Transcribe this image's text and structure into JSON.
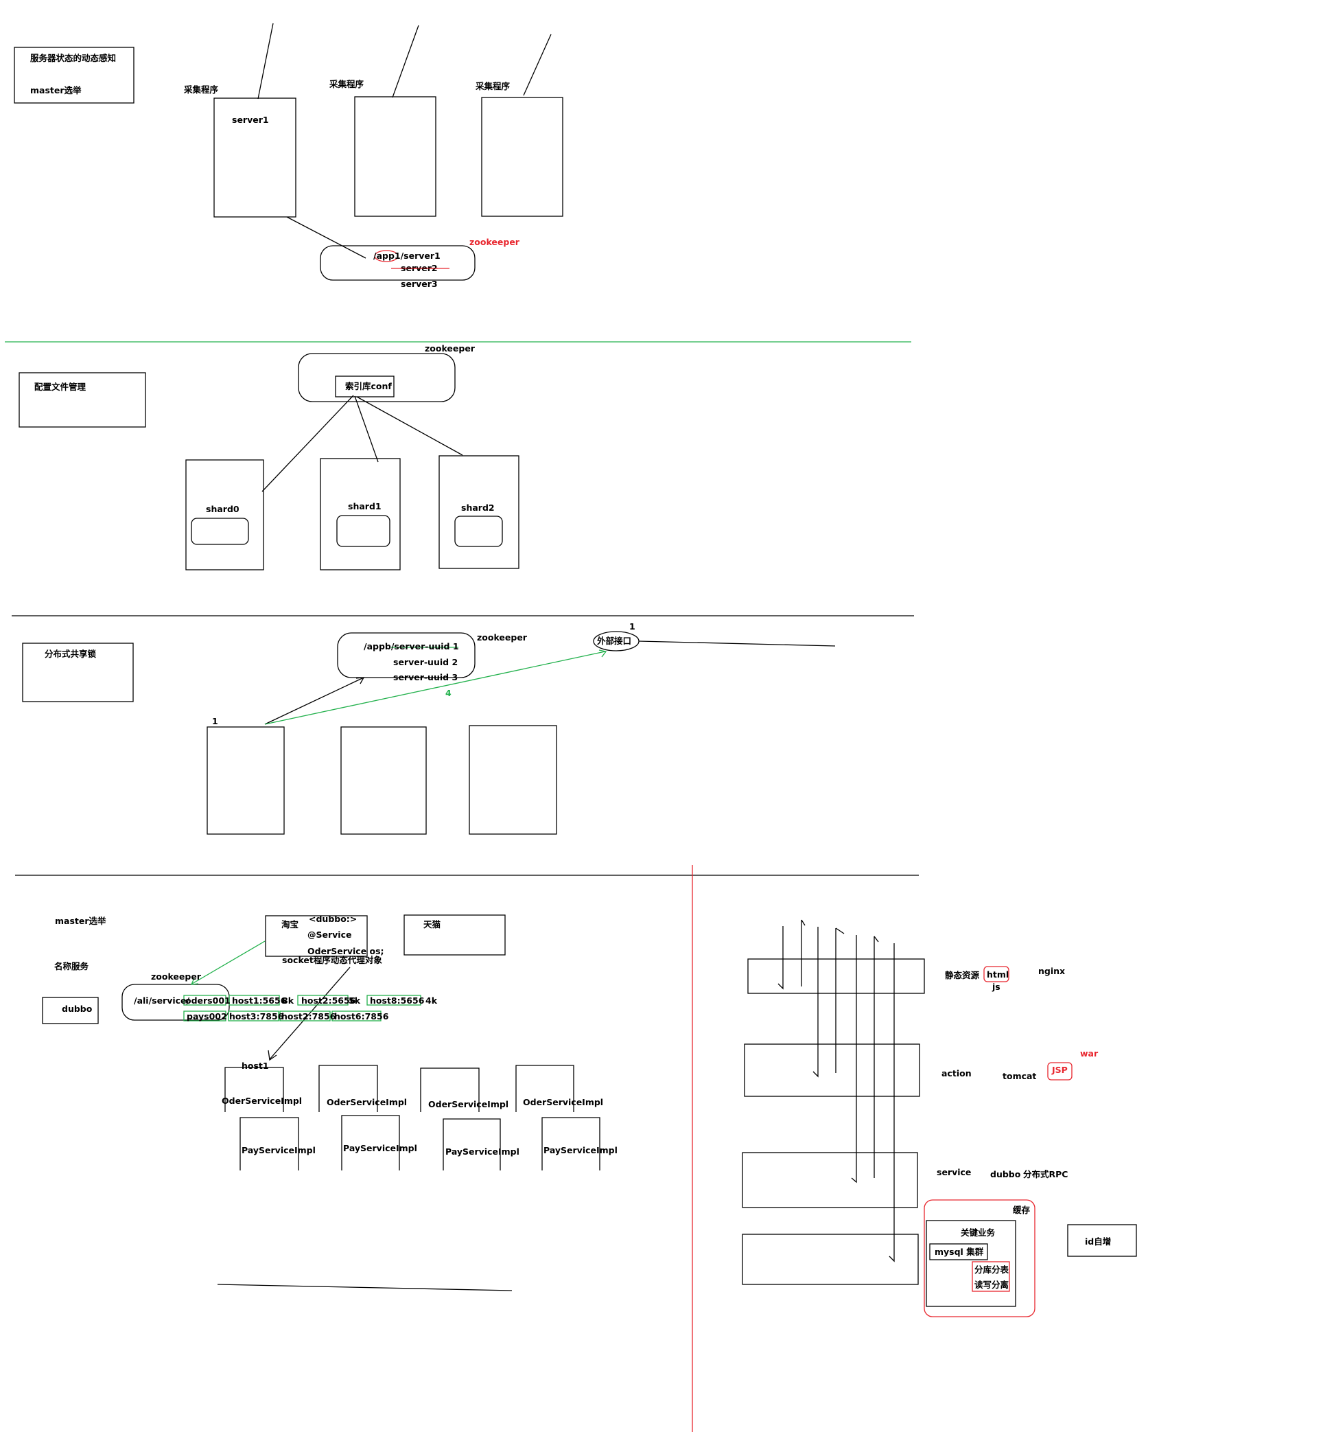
{
  "section1": {
    "title_lines": [
      "服务器状态的动态感知",
      "master选举"
    ],
    "collector_labels": [
      "采集程序",
      "采集程序",
      "采集程序"
    ],
    "server1_label": "server1",
    "zk_label": "zookeeper",
    "znode_lines": [
      "/app1/server1",
      "server2",
      "server3"
    ]
  },
  "section2": {
    "title": "配置文件管理",
    "zk_label": "zookeeper",
    "conf_label": "索引库conf",
    "shards": [
      "shard0",
      "shard1",
      "shard2"
    ]
  },
  "section3": {
    "title": "分布式共享锁",
    "zk_label": "zookeeper",
    "lock_lines": [
      "/appb/server-uuid 1",
      "server-uuid  2",
      "server-uuid  3"
    ],
    "green_num": "4",
    "api_label": "外部接口",
    "api_num": "1",
    "client_num": "1"
  },
  "section4": {
    "master_label": "master选举",
    "naming_label": "名称服务",
    "dubbo_box": "dubbo",
    "zk_label": "zookeeper",
    "taobao": "淘宝",
    "dubbo_tag": "<dubbo:>",
    "service_anno": "@Service",
    "oder_service": "OderService os;",
    "socket_text": "socket程序动态代理对象",
    "tmall": "天猫",
    "ali_path": "/ali/service/",
    "row1": [
      "oders001",
      "host1:5656",
      "8k",
      "host2:5656",
      "5k",
      "host8:5656",
      "4k"
    ],
    "row2": [
      "pays002",
      "host3:7856",
      "host2:7856",
      "host6:7856"
    ],
    "host1": "host1",
    "oder_impl": [
      "OderServiceImpl",
      "OderServiceImpl",
      "OderServiceImpl",
      "OderServiceImpl"
    ],
    "pay_impl": [
      "PayServiceImpl",
      "PayServiceImpl",
      "PayServiceImpl",
      "PayServiceImpl"
    ]
  },
  "architecture": {
    "static_res": "静态资源",
    "html": "html",
    "js": "js",
    "nginx": "nginx",
    "war": "war",
    "action": "action",
    "tomcat": "tomcat",
    "jsp": "JSP",
    "service": "service",
    "dubbo": "dubbo",
    "rpc": "分布式RPC",
    "cache": "缓存",
    "key_biz": "关键业务",
    "mysql": "mysql 集群",
    "sharding": "分库分表",
    "rw_split": "读写分离",
    "id_auto": "id自增"
  },
  "colors": {
    "red": "#e8262e",
    "green": "#22b14c",
    "black": "#000000"
  }
}
